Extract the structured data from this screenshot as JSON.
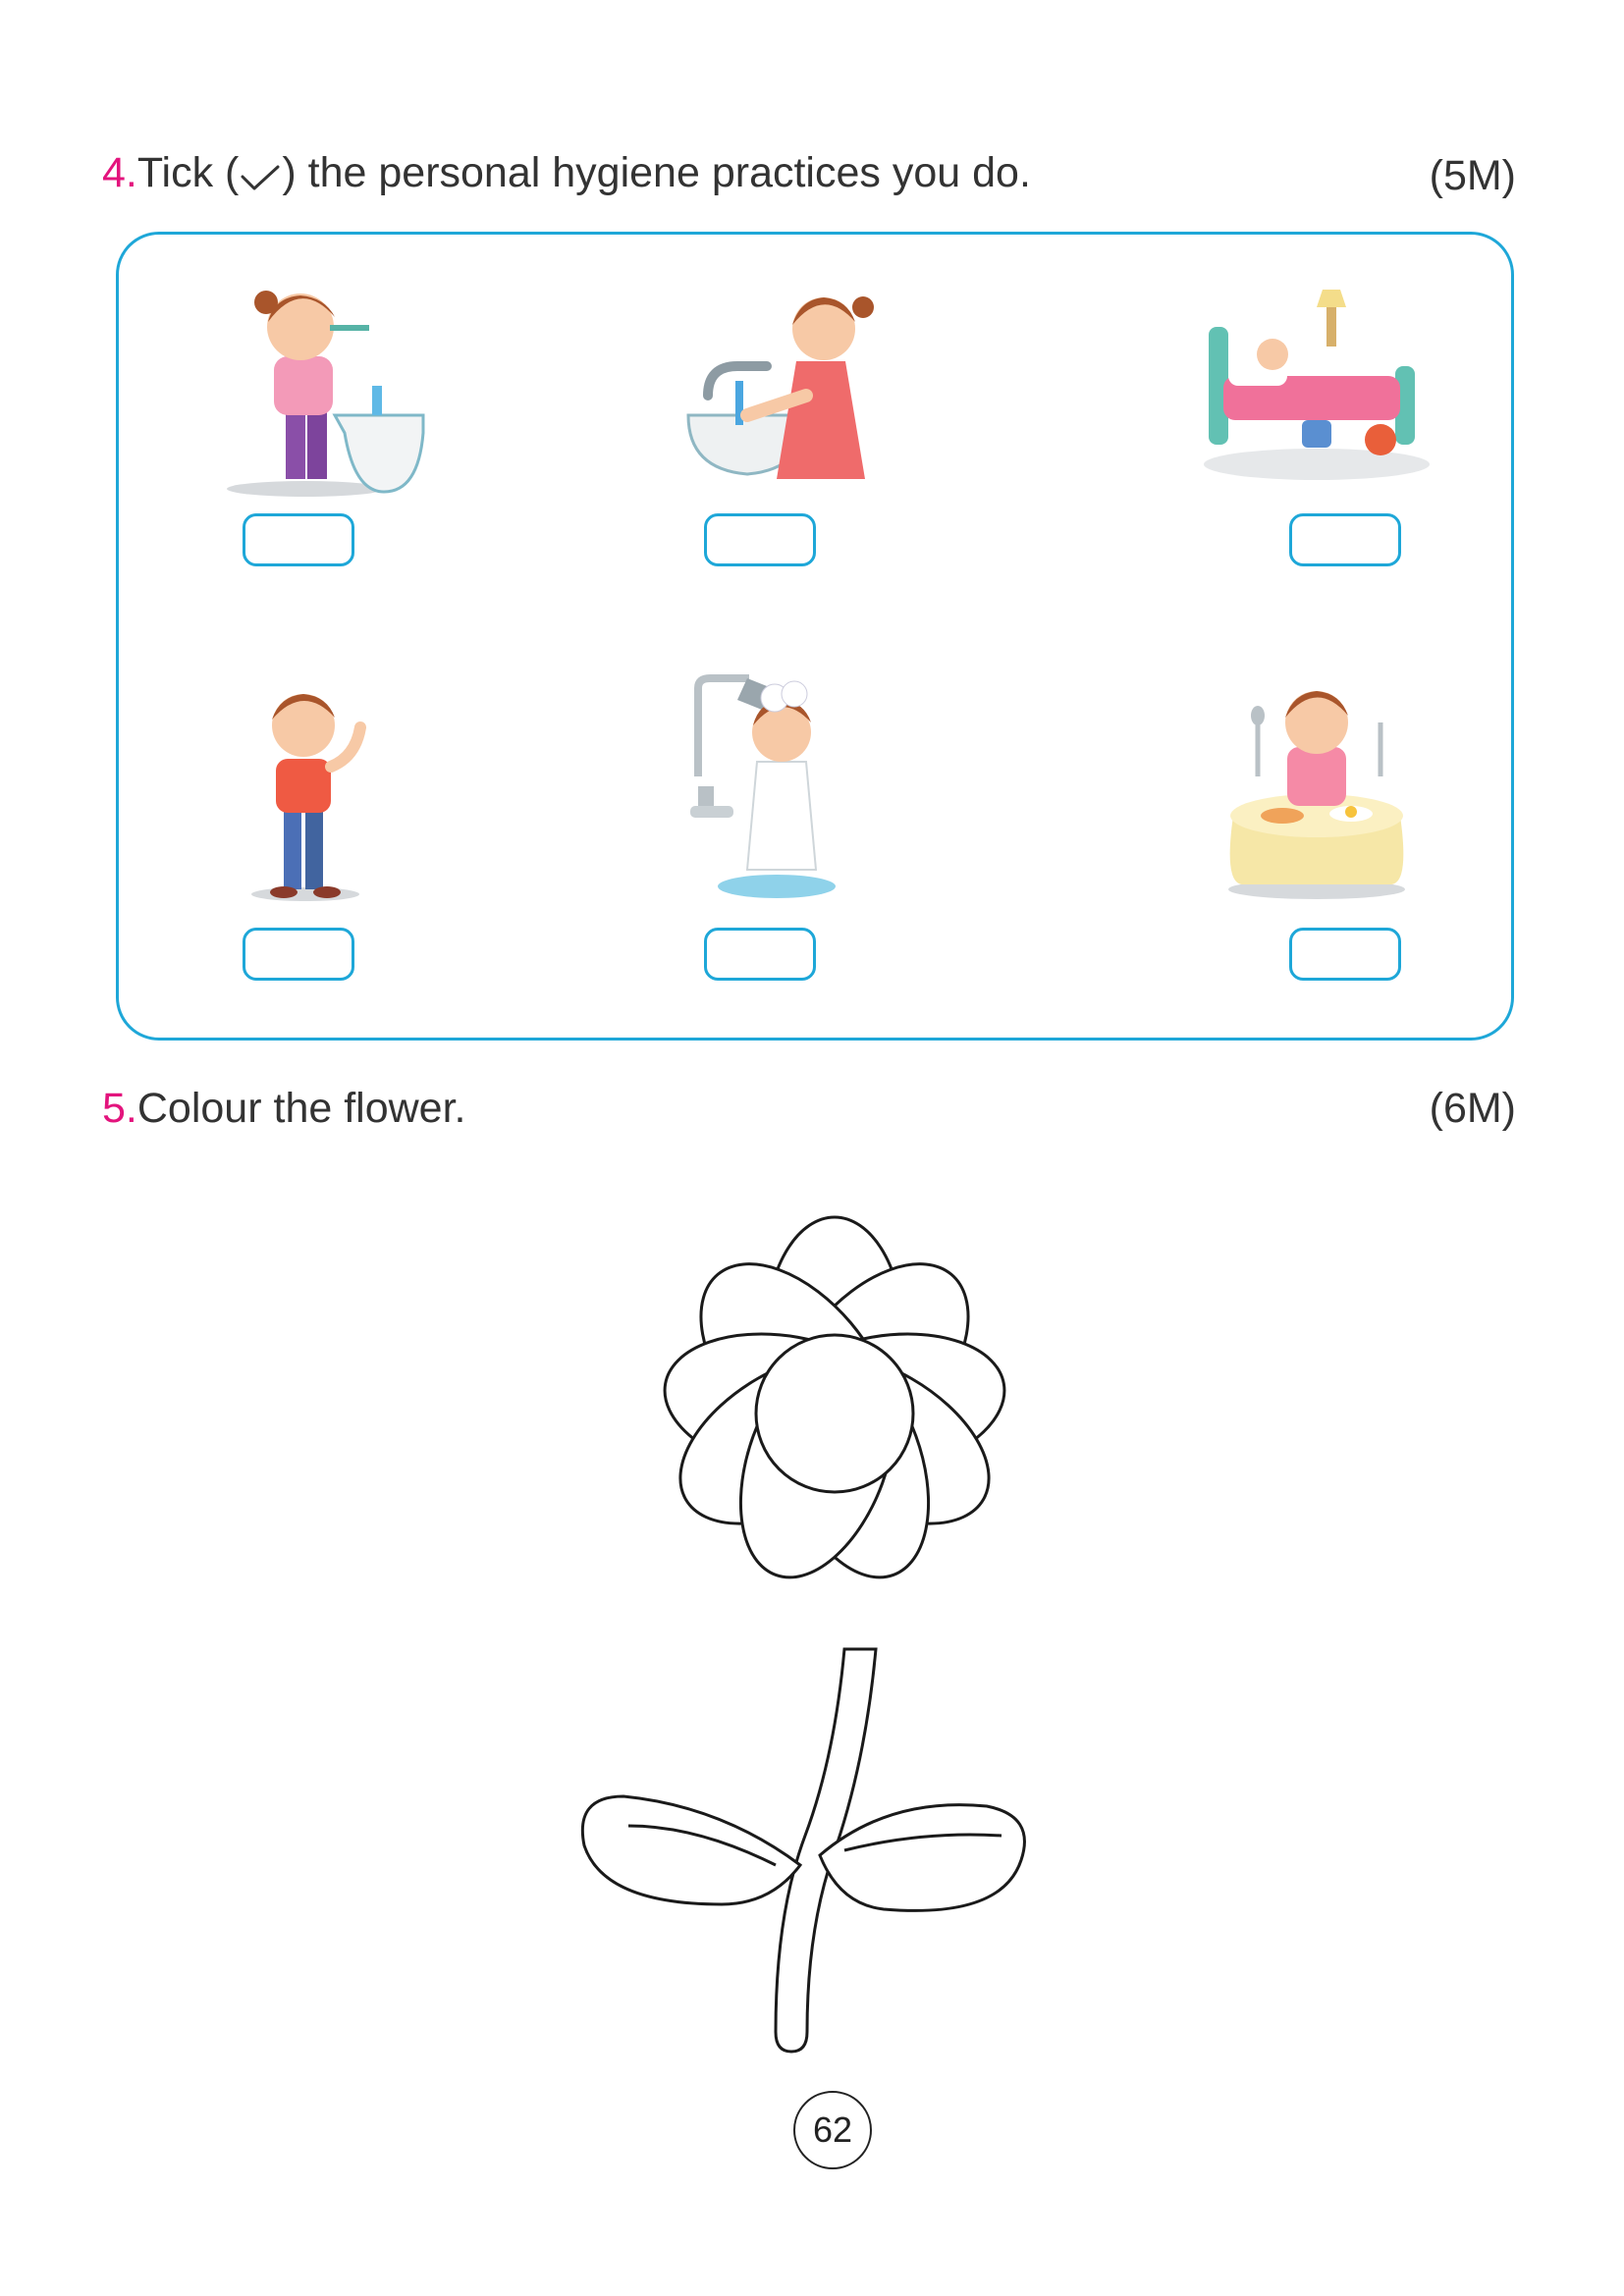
{
  "q4": {
    "number": "4.",
    "text_before": "Tick (",
    "text_after": ") the personal hygiene practices you do.",
    "marks": "(5M)"
  },
  "q5": {
    "number": "5.",
    "text": "Colour the flower.",
    "marks": "(6M)"
  },
  "activities": [
    {
      "icon": "brushing-teeth-icon"
    },
    {
      "icon": "washing-hands-icon"
    },
    {
      "icon": "sleeping-in-bed-icon"
    },
    {
      "icon": "child-stretching-icon"
    },
    {
      "icon": "bathing-shower-icon"
    },
    {
      "icon": "eating-food-icon"
    }
  ],
  "colors": {
    "accent": "#1ea7d8",
    "number": "#e3147d"
  },
  "page_number": "62"
}
